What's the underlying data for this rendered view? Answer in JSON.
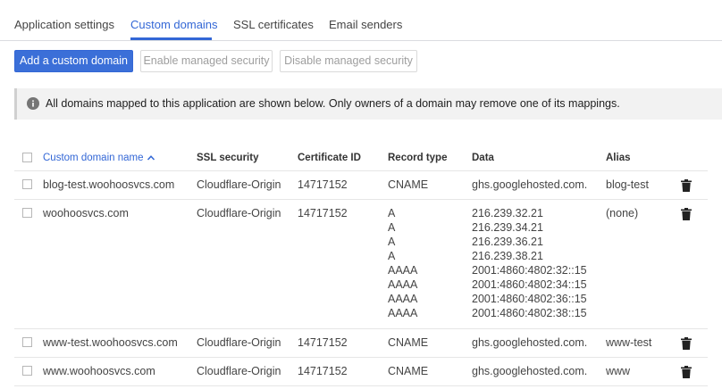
{
  "tabs": [
    {
      "label": "Application settings"
    },
    {
      "label": "Custom domains"
    },
    {
      "label": "SSL certificates"
    },
    {
      "label": "Email senders"
    }
  ],
  "toolbar": {
    "add_label": "Add a custom domain",
    "enable_label": "Enable managed security",
    "disable_label": "Disable managed security"
  },
  "banner": {
    "text": "All domains mapped to this application are shown below. Only owners of a domain may remove one of its mappings."
  },
  "table": {
    "headers": {
      "name": "Custom domain name",
      "ssl": "SSL security",
      "cert": "Certificate ID",
      "record": "Record type",
      "data": "Data",
      "alias": "Alias"
    },
    "rows": [
      {
        "name": "blog-test.woohoosvcs.com",
        "ssl": "Cloudflare-Origin",
        "cert": "14717152",
        "records": [
          "CNAME"
        ],
        "data": [
          "ghs.googlehosted.com."
        ],
        "alias": "blog-test"
      },
      {
        "name": "woohoosvcs.com",
        "ssl": "Cloudflare-Origin",
        "cert": "14717152",
        "records": [
          "A",
          "A",
          "A",
          "A",
          "AAAA",
          "AAAA",
          "AAAA",
          "AAAA"
        ],
        "data": [
          "216.239.32.21",
          "216.239.34.21",
          "216.239.36.21",
          "216.239.38.21",
          "2001:4860:4802:32::15",
          "2001:4860:4802:34::15",
          "2001:4860:4802:36::15",
          "2001:4860:4802:38::15"
        ],
        "alias": "(none)"
      },
      {
        "name": "www-test.woohoosvcs.com",
        "ssl": "Cloudflare-Origin",
        "cert": "14717152",
        "records": [
          "CNAME"
        ],
        "data": [
          "ghs.googlehosted.com."
        ],
        "alias": "www-test"
      },
      {
        "name": "www.woohoosvcs.com",
        "ssl": "Cloudflare-Origin",
        "cert": "14717152",
        "records": [
          "CNAME"
        ],
        "data": [
          "ghs.googlehosted.com."
        ],
        "alias": "www"
      }
    ]
  },
  "icons": {
    "info": "info-icon",
    "sort": "arrow-up-icon",
    "delete": "trash-icon"
  },
  "colors": {
    "accent": "#3367d6",
    "primary_button": "#3b6fd8"
  }
}
